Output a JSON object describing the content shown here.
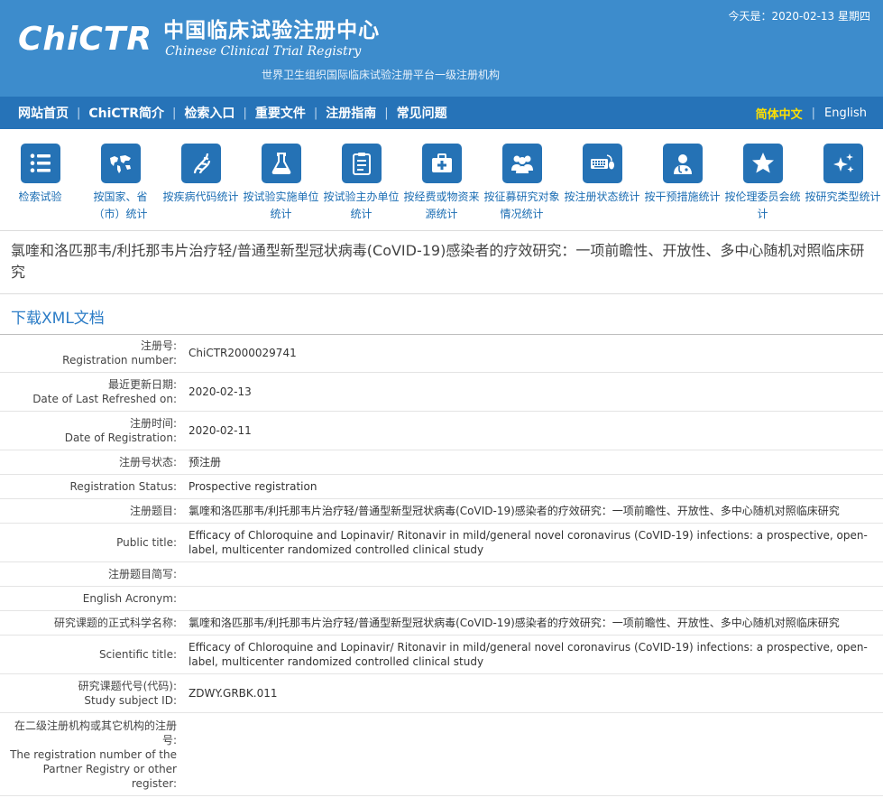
{
  "header": {
    "date_text": "今天是：2020-02-13 星期四",
    "logo_mark": "ChiCTR",
    "name_cn": "中国临床试验注册中心",
    "name_en": "Chinese Clinical Trial Registry",
    "subtitle": "世界卫生组织国际临床试验注册平台一级注册机构"
  },
  "nav": {
    "items": [
      "网站首页",
      "ChiCTR简介",
      "检索入口",
      "重要文件",
      "注册指南",
      "常见问题"
    ],
    "lang_active": "简体中文",
    "lang_other": "English"
  },
  "icons": [
    {
      "label": "检索试验",
      "icon": "list-icon"
    },
    {
      "label": "按国家、省（市）统计",
      "icon": "world-map-icon"
    },
    {
      "label": "按疾病代码统计",
      "icon": "dna-icon"
    },
    {
      "label": "按试验实施单位统计",
      "icon": "flask-icon"
    },
    {
      "label": "按试验主办单位统计",
      "icon": "clipboard-icon"
    },
    {
      "label": "按经费或物资来源统计",
      "icon": "medical-kit-icon"
    },
    {
      "label": "按征募研究对象情况统计",
      "icon": "group-icon"
    },
    {
      "label": "按注册状态统计",
      "icon": "keyboard-mouse-icon"
    },
    {
      "label": "按干预措施统计",
      "icon": "doctor-icon"
    },
    {
      "label": "按伦理委员会统计",
      "icon": "star-icon"
    },
    {
      "label": "按研究类型统计",
      "icon": "sparkle-icon"
    }
  ],
  "colors": {
    "header_bg": "#3d8ccc",
    "nav_bg": "#2673b8",
    "icon_bg": "#2572b5",
    "link": "#2b7cc6",
    "lang_active": "#ffe000"
  },
  "page_title": "氯喹和洛匹那韦/利托那韦片治疗轻/普通型新型冠状病毒(CoVID-19)感染者的疗效研究：一项前瞻性、开放性、多中心随机对照临床研究",
  "download_link": "下载XML文档",
  "rows": [
    {
      "label_cn": "注册号:",
      "label_en": "Registration number:",
      "value": "ChiCTR2000029741"
    },
    {
      "label_cn": "最近更新日期:",
      "label_en": "Date of Last Refreshed on:",
      "value": "2020-02-13"
    },
    {
      "label_cn": "注册时间:",
      "label_en": "Date of Registration:",
      "value": "2020-02-11"
    },
    {
      "label_cn": "注册号状态:",
      "label_en": "",
      "value": "预注册"
    },
    {
      "label_cn": "",
      "label_en": "Registration Status:",
      "value": "Prospective registration"
    },
    {
      "label_cn": "注册题目:",
      "label_en": "",
      "value": "氯喹和洛匹那韦/利托那韦片治疗轻/普通型新型冠状病毒(CoVID-19)感染者的疗效研究：一项前瞻性、开放性、多中心随机对照临床研究"
    },
    {
      "label_cn": "",
      "label_en": "Public title:",
      "value": "Efficacy of Chloroquine and Lopinavir/ Ritonavir in mild/general novel coronavirus (CoVID-19) infections: a prospective, open-label, multicenter randomized controlled clinical study"
    },
    {
      "label_cn": "注册题目简写:",
      "label_en": "",
      "value": ""
    },
    {
      "label_cn": "",
      "label_en": "English Acronym:",
      "value": ""
    },
    {
      "label_cn": "研究课题的正式科学名称:",
      "label_en": "",
      "value": "氯喹和洛匹那韦/利托那韦片治疗轻/普通型新型冠状病毒(CoVID-19)感染者的疗效研究：一项前瞻性、开放性、多中心随机对照临床研究"
    },
    {
      "label_cn": "",
      "label_en": "Scientific title:",
      "value": "Efficacy of Chloroquine and Lopinavir/ Ritonavir in mild/general novel coronavirus (CoVID-19) infections: a prospective, open-label, multicenter randomized controlled clinical study"
    },
    {
      "label_cn": "研究课题代号(代码):",
      "label_en": "Study subject ID:",
      "value": "ZDWY.GRBK.011"
    },
    {
      "label_cn": "在二级注册机构或其它机构的注册号:",
      "label_en": "The registration number of the Partner Registry or other register:",
      "value": ""
    }
  ]
}
